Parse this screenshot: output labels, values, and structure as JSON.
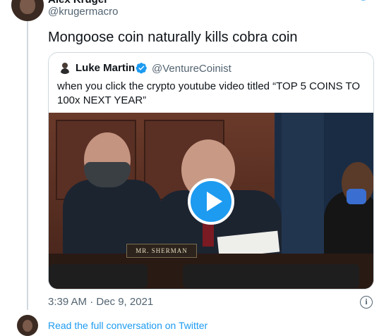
{
  "tweet": {
    "author_name": "Alex Krüger",
    "author_handle": "@krugermacro",
    "text": "Mongoose coin naturally kills cobra coin",
    "timestamp": "3:39 AM · Dec 9, 2021",
    "icons": [
      "avatar",
      "twitter-bird-icon",
      "info-icon"
    ]
  },
  "quoted_tweet": {
    "author_name": "Luke Martin",
    "author_handle": "@VentureCoinist",
    "verified": true,
    "text": "when you click the crypto youtube video titled “TOP 5 COINS TO 100x NEXT YEAR”",
    "video": {
      "nameplate": "MR. SHERMAN",
      "play_icon": "play-icon"
    }
  },
  "footer": {
    "link_text": "Read the full conversation on Twitter"
  },
  "colors": {
    "accent": "#1d9bf0",
    "secondary_text": "#536471",
    "border": "#cfd9de"
  }
}
